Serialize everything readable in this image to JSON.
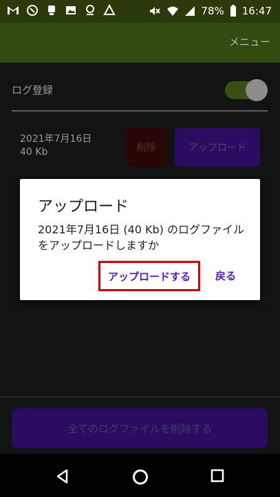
{
  "status_bar": {
    "battery": "78%",
    "time": "16:47",
    "left_icons": [
      "gmail-icon",
      "app-icon",
      "app-icon",
      "image-icon",
      "location-icon",
      "drive-icon"
    ],
    "right_icons": [
      "mute-icon",
      "wifi-icon",
      "signal-icon",
      "battery-icon"
    ]
  },
  "app_bar": {
    "menu": "メニュー"
  },
  "settings": {
    "log_label": "ログ登録",
    "log_enabled": true
  },
  "file_item": {
    "date": "2021年7月16日",
    "size": "40 Kb",
    "delete_label": "削除",
    "upload_label": "アップロード"
  },
  "delete_all_label": "全てのログファイルを削除する",
  "dialog": {
    "title": "アップロード",
    "message": "2021年7月16日 (40 Kb) のログファイルをアップロードしますか",
    "confirm_label": "アップロードする",
    "back_label": "戻る"
  },
  "nav": {
    "icons": [
      "back-icon",
      "home-icon",
      "recents-icon"
    ]
  },
  "colors": {
    "app_bar": "#334a10",
    "accent": "#5b16c9",
    "highlight": "#e00000"
  }
}
